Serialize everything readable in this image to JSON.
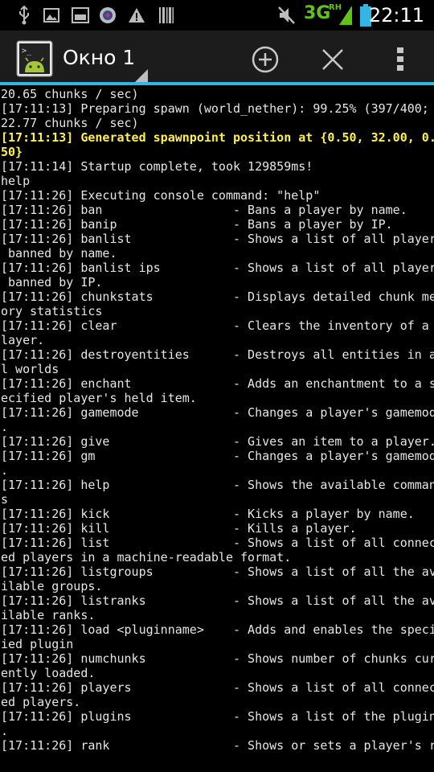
{
  "status_bar": {
    "network": "3G",
    "network_sub": "RH",
    "time": "22:11",
    "icons": [
      "usb-icon",
      "image-icon",
      "screenshot-icon",
      "app-badge-icon",
      "warning-icon",
      "barcode-icon",
      "mute-icon",
      "signal-icon",
      "battery-icon"
    ]
  },
  "action_bar": {
    "title": "Окно 1",
    "icons": [
      "terminal-app-icon",
      "add-window-icon",
      "close-window-icon",
      "overflow-menu-icon"
    ]
  },
  "console": {
    "lines": [
      {
        "text": "20.65 chunks / sec)",
        "hl": false
      },
      {
        "text": "[17:11:13] Preparing spawn (world_nether): 99.25% (397/400;",
        "hl": false
      },
      {
        "text": "22.77 chunks / sec)",
        "hl": false
      },
      {
        "text": "[17:11:13] Generated spawnpoint position at {0.50, 32.00, 0.",
        "hl": true
      },
      {
        "text": "50}",
        "hl": true
      },
      {
        "text": "[17:11:14] Startup complete, took 129859ms!",
        "hl": false
      },
      {
        "text": "help",
        "hl": false
      },
      {
        "text": "[17:11:26] Executing console command: \"help\"",
        "hl": false
      },
      {
        "text": "[17:11:26] ban                  - Bans a player by name.",
        "hl": false
      },
      {
        "text": "[17:11:26] banip                - Bans a player by IP.",
        "hl": false
      },
      {
        "text": "[17:11:26] banlist              - Shows a list of all players",
        "hl": false
      },
      {
        "text": " banned by name.",
        "hl": false
      },
      {
        "text": "[17:11:26] banlist ips          - Shows a list of all players",
        "hl": false
      },
      {
        "text": " banned by IP.",
        "hl": false
      },
      {
        "text": "[17:11:26] chunkstats           - Displays detailed chunk mem",
        "hl": false
      },
      {
        "text": "ory statistics",
        "hl": false
      },
      {
        "text": "[17:11:26] clear                - Clears the inventory of a p",
        "hl": false
      },
      {
        "text": "layer.",
        "hl": false
      },
      {
        "text": "[17:11:26] destroyentities      - Destroys all entities in al",
        "hl": false
      },
      {
        "text": "l worlds",
        "hl": false
      },
      {
        "text": "[17:11:26] enchant              - Adds an enchantment to a sp",
        "hl": false
      },
      {
        "text": "ecified player's held item.",
        "hl": false
      },
      {
        "text": "[17:11:26] gamemode             - Changes a player's gamemode",
        "hl": false
      },
      {
        "text": ".",
        "hl": false
      },
      {
        "text": "[17:11:26] give                 - Gives an item to a player.",
        "hl": false
      },
      {
        "text": "[17:11:26] gm                   - Changes a player's gamemode",
        "hl": false
      },
      {
        "text": ".",
        "hl": false
      },
      {
        "text": "[17:11:26] help                 - Shows the available command",
        "hl": false
      },
      {
        "text": "s",
        "hl": false
      },
      {
        "text": "[17:11:26] kick                 - Kicks a player by name.",
        "hl": false
      },
      {
        "text": "[17:11:26] kill                 - Kills a player.",
        "hl": false
      },
      {
        "text": "[17:11:26] list                 - Shows a list of all connect",
        "hl": false
      },
      {
        "text": "ed players in a machine-readable format.",
        "hl": false
      },
      {
        "text": "[17:11:26] listgroups           - Shows a list of all the ava",
        "hl": false
      },
      {
        "text": "ilable groups.",
        "hl": false
      },
      {
        "text": "[17:11:26] listranks            - Shows a list of all the ava",
        "hl": false
      },
      {
        "text": "ilable ranks.",
        "hl": false
      },
      {
        "text": "[17:11:26] load <pluginname>    - Adds and enables the specif",
        "hl": false
      },
      {
        "text": "ied plugin",
        "hl": false
      },
      {
        "text": "[17:11:26] numchunks            - Shows number of chunks curr",
        "hl": false
      },
      {
        "text": "ently loaded.",
        "hl": false
      },
      {
        "text": "[17:11:26] players              - Shows a list of all connect",
        "hl": false
      },
      {
        "text": "ed players.",
        "hl": false
      },
      {
        "text": "[17:11:26] plugins              - Shows a list of the plugins",
        "hl": false
      },
      {
        "text": ".",
        "hl": false
      },
      {
        "text": "[17:11:26] rank                 - Shows or sets a player's ra",
        "hl": false
      }
    ]
  }
}
